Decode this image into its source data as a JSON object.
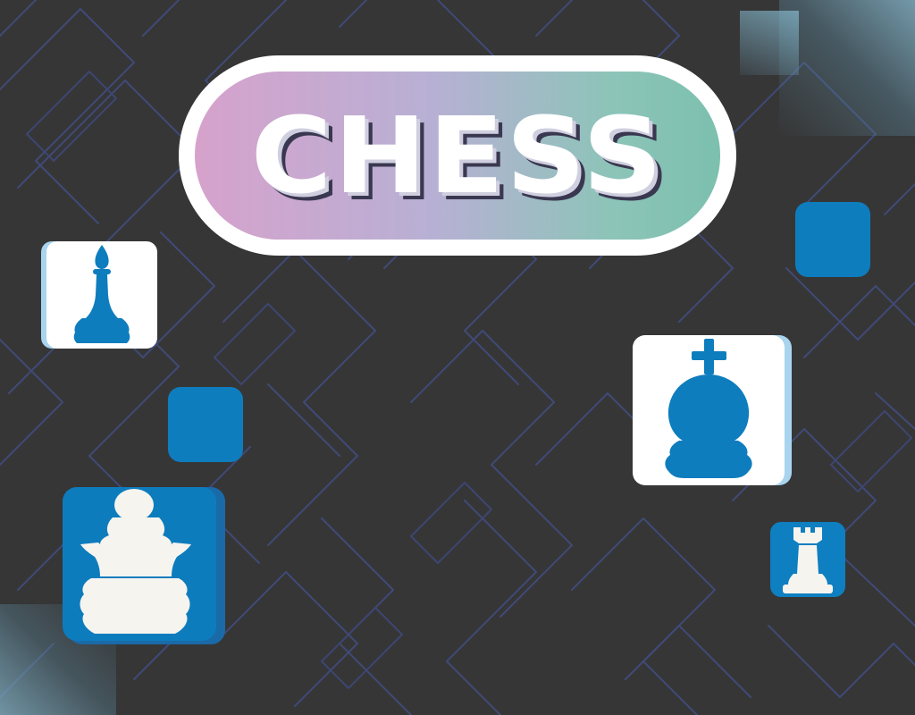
{
  "title": {
    "text": "CHESS"
  },
  "colors": {
    "background": "#363636",
    "maze_lines": "#414a78",
    "accent_blue": "#0e7dbe",
    "light_blue": "#a8d4ee",
    "piece_white": "#f6f4ef",
    "gradient_pink": "#d6a2cc",
    "gradient_teal": "#7cc0ae"
  },
  "pieces": [
    {
      "name": "bishop",
      "icon": "bishop-icon",
      "tile_color": "white",
      "piece_color": "blue"
    },
    {
      "name": "king",
      "icon": "king-icon",
      "tile_color": "white",
      "piece_color": "blue"
    },
    {
      "name": "pawn",
      "icon": "pawn-icon",
      "tile_color": "blue",
      "piece_color": "white"
    },
    {
      "name": "rook",
      "icon": "rook-icon",
      "tile_color": "blue",
      "piece_color": "white"
    }
  ]
}
